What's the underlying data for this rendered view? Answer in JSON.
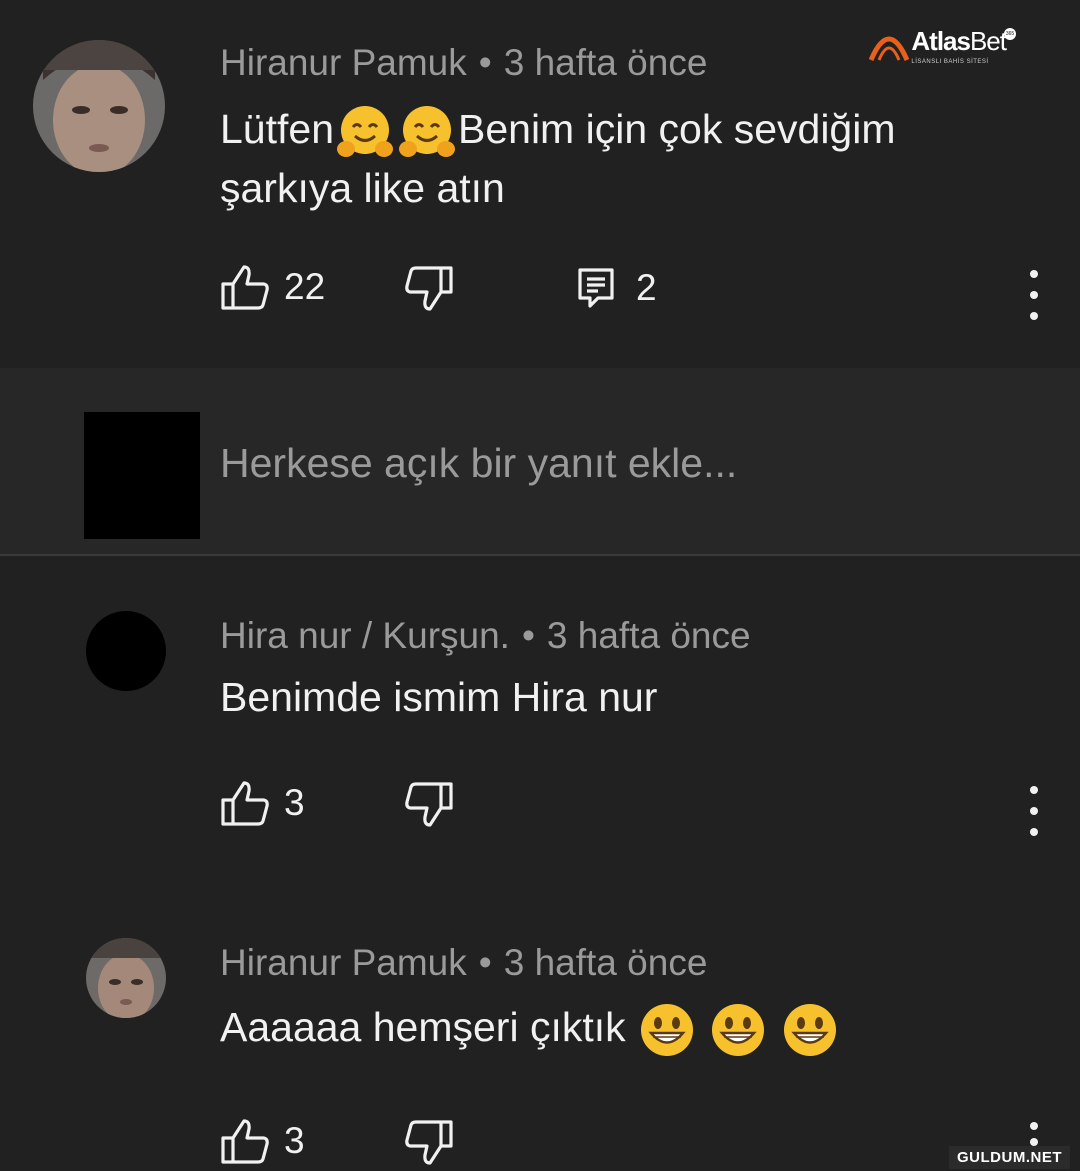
{
  "watermark_logo": {
    "name_bold": "Atlas",
    "name_regular": "Bet",
    "subtitle": "LİSANSLI BAHİS SİTESİ",
    "badge": "365",
    "accent": "#e8601c"
  },
  "comments": [
    {
      "author": "Hiranur Pamuk",
      "separator": "•",
      "time": "3 hafta önce",
      "text_before": "Lütfen",
      "text_after": "Benim için çok sevdiğim şarkıya like atın",
      "emojis": [
        "hugging-face",
        "hugging-face"
      ],
      "likes": "22",
      "replies": "2"
    },
    {
      "author": "Hira nur / Kurşun.",
      "separator": "•",
      "time": "3 hafta önce",
      "text": "Benimde ismim Hira nur",
      "likes": "3"
    },
    {
      "author": "Hiranur Pamuk",
      "separator": "•",
      "time": "3 hafta önce",
      "text": "Aaaaaa hemşeri çıktık",
      "emojis": [
        "grinning-face",
        "grinning-face",
        "grinning-face"
      ],
      "likes": "3"
    }
  ],
  "reply_input": {
    "placeholder": "Herkese açık bir yanıt ekle..."
  },
  "site_watermark": "GULDUM.NET",
  "colors": {
    "background": "#212121",
    "reply_area": "#272727",
    "primary_text": "#f1f1f1",
    "secondary_text": "#9a9a9a"
  }
}
